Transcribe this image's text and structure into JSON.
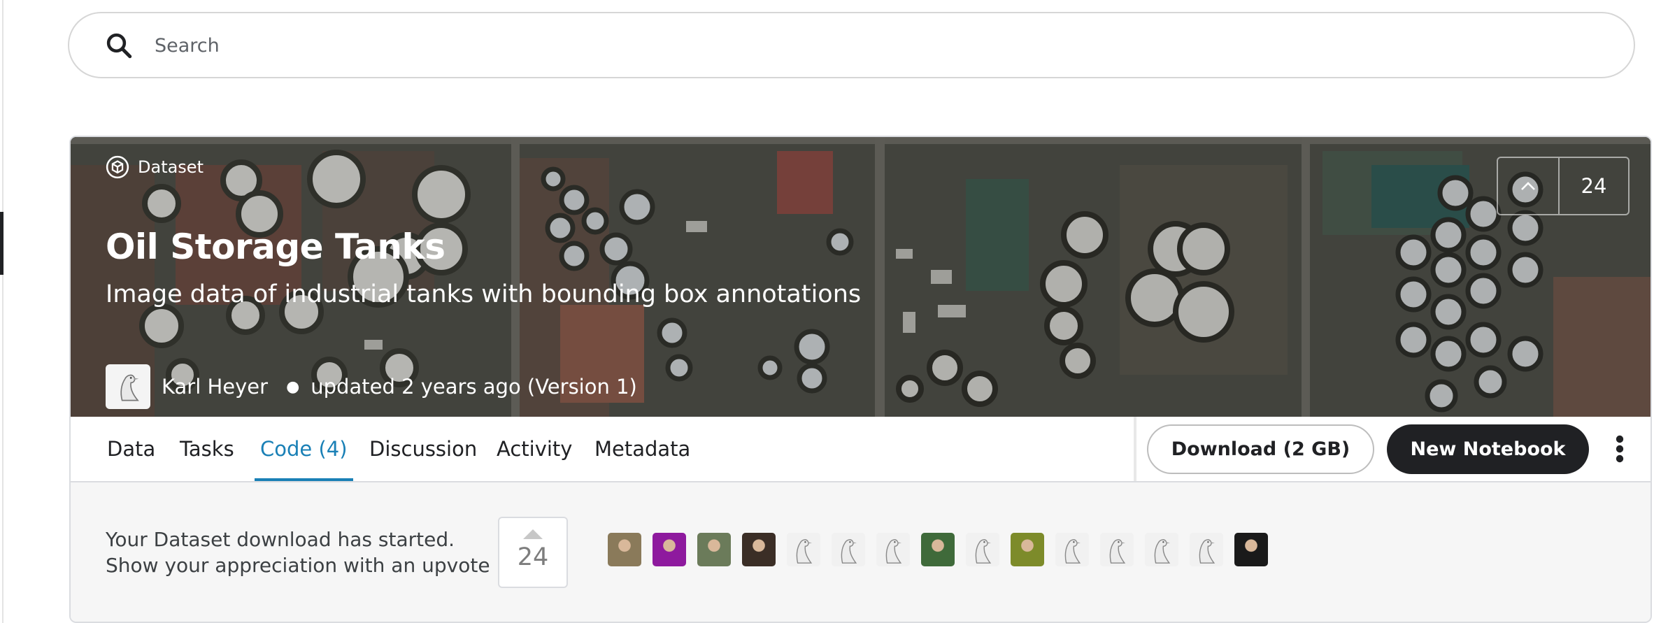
{
  "search": {
    "placeholder": "Search"
  },
  "dataset": {
    "kind_label": "Dataset",
    "title": "Oil Storage Tanks",
    "subtitle": "Image data of industrial tanks with bounding box annotations",
    "author": "Karl Heyer",
    "updated": "updated 2 years ago (Version 1)",
    "upvotes": "24"
  },
  "tabs": [
    {
      "label": "Data"
    },
    {
      "label": "Tasks"
    },
    {
      "label": "Code (4)"
    },
    {
      "label": "Discussion"
    },
    {
      "label": "Activity"
    },
    {
      "label": "Metadata"
    }
  ],
  "active_tab": "Code (4)",
  "actions": {
    "download_label": "Download (2 GB)",
    "notebook_label": "New Notebook"
  },
  "appreciation": {
    "line1": "Your Dataset download has started.",
    "line2": "Show your appreciation with an upvote",
    "count": "24"
  },
  "voters": [
    {
      "kind": "photo",
      "color": "#8a7a5a"
    },
    {
      "kind": "photo",
      "color": "#8e1a9e"
    },
    {
      "kind": "photo",
      "color": "#6b7b5a"
    },
    {
      "kind": "photo",
      "color": "#3b2e26"
    },
    {
      "kind": "goose-icon"
    },
    {
      "kind": "goose-icon"
    },
    {
      "kind": "goose-icon"
    },
    {
      "kind": "photo",
      "color": "#3f6a3a"
    },
    {
      "kind": "goose-icon"
    },
    {
      "kind": "photo",
      "color": "#7d8b2a"
    },
    {
      "kind": "goose-icon"
    },
    {
      "kind": "goose-icon"
    },
    {
      "kind": "goose-icon"
    },
    {
      "kind": "goose-icon"
    },
    {
      "kind": "photo",
      "color": "#1a1a1a"
    }
  ],
  "colors": {
    "accent": "#1a80b6",
    "dark_button": "#202124",
    "panel_bg": "#f6f6f6"
  }
}
